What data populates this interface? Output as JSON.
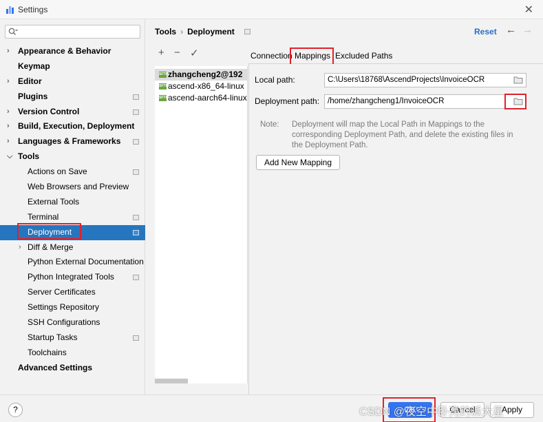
{
  "window": {
    "title": "Settings",
    "close_glyph": "✕",
    "app_icon": "jetbrains-icon"
  },
  "search": {
    "placeholder": "",
    "icon": "search-icon"
  },
  "sidebar": {
    "items": [
      {
        "label": "Appearance & Behavior",
        "level": 0,
        "expandable": true,
        "expanded": false,
        "marker": false
      },
      {
        "label": "Keymap",
        "level": 0,
        "expandable": false,
        "marker": false
      },
      {
        "label": "Editor",
        "level": 0,
        "expandable": true,
        "expanded": false,
        "marker": false
      },
      {
        "label": "Plugins",
        "level": 0,
        "expandable": false,
        "marker": true
      },
      {
        "label": "Version Control",
        "level": 0,
        "expandable": true,
        "expanded": false,
        "marker": true
      },
      {
        "label": "Build, Execution, Deployment",
        "level": 0,
        "expandable": true,
        "expanded": false,
        "marker": false
      },
      {
        "label": "Languages & Frameworks",
        "level": 0,
        "expandable": true,
        "expanded": false,
        "marker": true
      },
      {
        "label": "Tools",
        "level": 0,
        "expandable": true,
        "expanded": true,
        "marker": false
      },
      {
        "label": "Actions on Save",
        "level": 1,
        "expandable": false,
        "marker": true
      },
      {
        "label": "Web Browsers and Preview",
        "level": 1,
        "expandable": false,
        "marker": false
      },
      {
        "label": "External Tools",
        "level": 1,
        "expandable": false,
        "marker": false
      },
      {
        "label": "Terminal",
        "level": 1,
        "expandable": false,
        "marker": true
      },
      {
        "label": "Deployment",
        "level": 1,
        "expandable": false,
        "marker": true,
        "selected": true
      },
      {
        "label": "Diff & Merge",
        "level": 1,
        "expandable": true,
        "expanded": false,
        "marker": false
      },
      {
        "label": "Python External Documentation",
        "level": 1,
        "expandable": false,
        "marker": false
      },
      {
        "label": "Python Integrated Tools",
        "level": 1,
        "expandable": false,
        "marker": true
      },
      {
        "label": "Server Certificates",
        "level": 1,
        "expandable": false,
        "marker": false
      },
      {
        "label": "Settings Repository",
        "level": 1,
        "expandable": false,
        "marker": false
      },
      {
        "label": "SSH Configurations",
        "level": 1,
        "expandable": false,
        "marker": false
      },
      {
        "label": "Startup Tasks",
        "level": 1,
        "expandable": false,
        "marker": true
      },
      {
        "label": "Toolchains",
        "level": 1,
        "expandable": false,
        "marker": false
      },
      {
        "label": "Advanced Settings",
        "level": 0,
        "expandable": false,
        "marker": false
      }
    ]
  },
  "header": {
    "breadcrumb": [
      "Tools",
      "Deployment"
    ],
    "breadcrumb_sep": "›",
    "reset_label": "Reset",
    "back_glyph": "←",
    "forward_glyph": "→"
  },
  "toolbar": {
    "add_glyph": "+",
    "remove_glyph": "−",
    "check_glyph": "✓"
  },
  "servers": [
    {
      "name": "zhangcheng2@192",
      "badge": "SFTP",
      "selected": true
    },
    {
      "name": "ascend-x86_64-linux",
      "badge": "SFTP",
      "selected": false
    },
    {
      "name": "ascend-aarch64-linux",
      "badge": "SFTP",
      "selected": false
    }
  ],
  "tabs": [
    "Connection",
    "Mappings",
    "Excluded Paths"
  ],
  "active_tab": "Mappings",
  "mapping": {
    "local_path_label": "Local path:",
    "local_path_value": "C:\\Users\\18768\\AscendProjects\\InvoiceOCR",
    "deployment_path_label": "Deployment path:",
    "deployment_path_value": "/home/zhangcheng1/InvoiceOCR",
    "note_label": "Note:",
    "note_lines": [
      "Deployment will map the Local Path in Mappings to the",
      "corresponding Deployment Path, and delete the existing files in",
      "the Deployment Path."
    ],
    "add_mapping_label": "Add New Mapping"
  },
  "footer": {
    "help_label": "?",
    "ok_label": "OK",
    "cancel_label": "Cancel",
    "apply_label": "Apply",
    "watermark": "CSDN @夜空中卧亮的派大星"
  },
  "colors": {
    "accent": "#2675bf",
    "highlight_box": "#e0202a",
    "sftp_badge": "#68a53f",
    "link": "#2670c2"
  }
}
